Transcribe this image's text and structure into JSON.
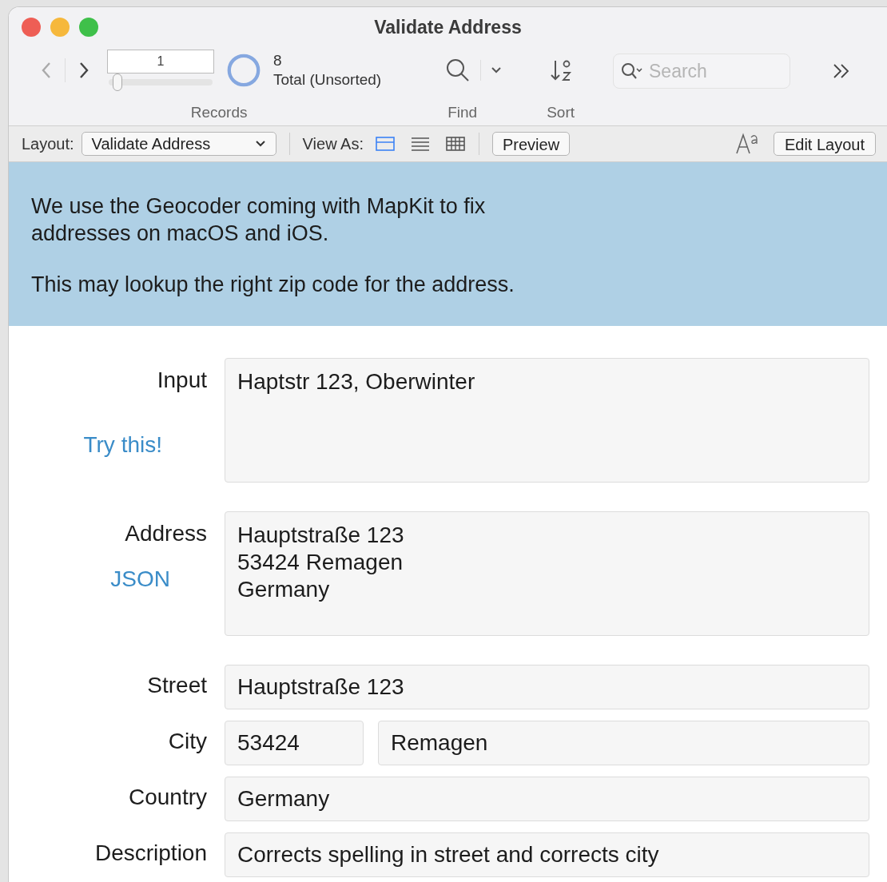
{
  "window": {
    "title": "Validate Address"
  },
  "toolbar": {
    "record_number": "1",
    "record_slider": {
      "level": 0.04
    },
    "record_count": "8",
    "record_total": "Total (Unsorted)",
    "records_label": "Records",
    "find_label": "Find",
    "sort_label": "Sort",
    "search": {
      "placeholder": "Search"
    }
  },
  "layout_bar": {
    "layout_label": "Layout:",
    "layout_value": "Validate Address",
    "view_as_label": "View As:",
    "view_modes": [
      {
        "kind": "form",
        "selected": true
      },
      {
        "kind": "list",
        "selected": false
      },
      {
        "kind": "table",
        "selected": false
      }
    ],
    "preview_button": "Preview",
    "edit_layout_button": "Edit Layout"
  },
  "banner": {
    "paragraphs": [
      "We use the Geocoder coming with MapKit to fix\naddresses on macOS and iOS.",
      "This may lookup the right zip code for the address."
    ]
  },
  "form": {
    "fields": [
      {
        "label": "Input",
        "link": "Try this!",
        "kind": "tall",
        "values": [
          "Haptstr 123, Oberwinter"
        ]
      },
      {
        "label": "Address",
        "link": "JSON",
        "kind": "tall",
        "values": [
          "Hauptstraße 123\n53424 Remagen\nGermany"
        ]
      },
      {
        "label": "Street",
        "kind": "single",
        "values": [
          "Hauptstraße 123"
        ]
      },
      {
        "label": "City",
        "kind": "split",
        "values": [
          "53424",
          "Remagen"
        ]
      },
      {
        "label": "Country",
        "kind": "single",
        "values": [
          "Germany"
        ]
      },
      {
        "label": "Description",
        "kind": "single",
        "values": [
          "Corrects spelling in street and corrects city"
        ]
      }
    ]
  }
}
